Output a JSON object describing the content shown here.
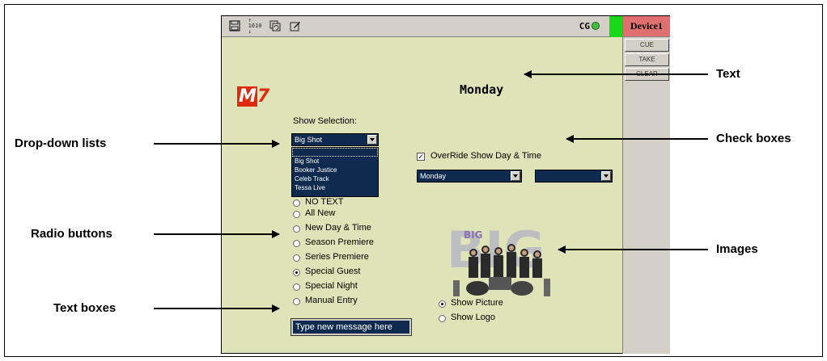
{
  "toolbar": {
    "icons": [
      "save-icon",
      "binary-icon",
      "refresh-icon",
      "edit-icon"
    ],
    "cg_label": "CG"
  },
  "device": {
    "title": "Device1",
    "buttons": [
      "CUE",
      "TAKE",
      "CLEAR"
    ]
  },
  "logo": {
    "letter": "M",
    "number": "7"
  },
  "day_text": "Monday",
  "show_selection": {
    "label": "Show Selection:",
    "value": "Big Shot",
    "options": [
      "",
      "Big Shot",
      "Booker Justice",
      "Celeb Track",
      "Tessa Live"
    ]
  },
  "override": {
    "label": "OverRide Show Day & Time",
    "checked": true,
    "day_value": "Monday",
    "time_value": ""
  },
  "radio_options": [
    {
      "label": "NO TEXT",
      "checked": false
    },
    {
      "label": "All New",
      "checked": false
    },
    {
      "label": "New Day & Time",
      "checked": false
    },
    {
      "label": "Season Premiere",
      "checked": false
    },
    {
      "label": "Series Premiere",
      "checked": false
    },
    {
      "label": "Special Guest",
      "checked": true
    },
    {
      "label": "Special Night",
      "checked": false
    },
    {
      "label": "Manual Entry",
      "checked": false
    }
  ],
  "picture_options": [
    {
      "label": "Show Picture",
      "checked": true
    },
    {
      "label": "Show Logo",
      "checked": false
    }
  ],
  "textbox": {
    "value": "Type new message here"
  },
  "image": {
    "caption": "BIG"
  },
  "annotations": {
    "text": "Text",
    "check_boxes": "Check boxes",
    "dropdown_lists": "Drop-down lists",
    "radio_buttons": "Radio buttons",
    "images": "Images",
    "text_boxes": "Text boxes"
  },
  "colors": {
    "app_bg": "#dfe4b8",
    "device_title": "#e07070",
    "cg_status": "#19d719",
    "control_bg": "#0e2a4e",
    "logo_red": "#e02a10"
  }
}
